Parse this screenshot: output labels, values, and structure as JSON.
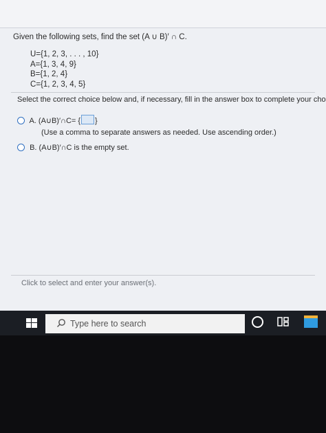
{
  "question": {
    "prompt": "Given the following sets, find the set (A ∪ B)′ ∩ C.",
    "sets": [
      "U={1, 2, 3, . . . , 10}",
      "A={1, 3, 4, 9}",
      "B={1, 2, 4}",
      "C={1, 2, 3, 4, 5}"
    ]
  },
  "instruction": "Select the correct choice below and, if necessary, fill in the answer box to complete your choice.",
  "options": {
    "a": {
      "letter": "A.",
      "text_before": "(A∪B)′∩C= {",
      "text_after": "}",
      "answer_value": "",
      "note": "(Use a comma to separate answers as needed. Use ascending order.)"
    },
    "b": {
      "letter": "B.",
      "text": "(A∪B)′∩C is the empty set."
    }
  },
  "footer": {
    "hint": "Click to select and enter your answer(s)."
  },
  "taskbar": {
    "search_placeholder": "Type here to search",
    "icons": [
      "windows-start-icon",
      "search-icon",
      "cortana-icon",
      "task-view-icon",
      "app-icon"
    ]
  },
  "colors": {
    "accent": "#2f6fc0",
    "taskbar": "#1b1e24"
  }
}
